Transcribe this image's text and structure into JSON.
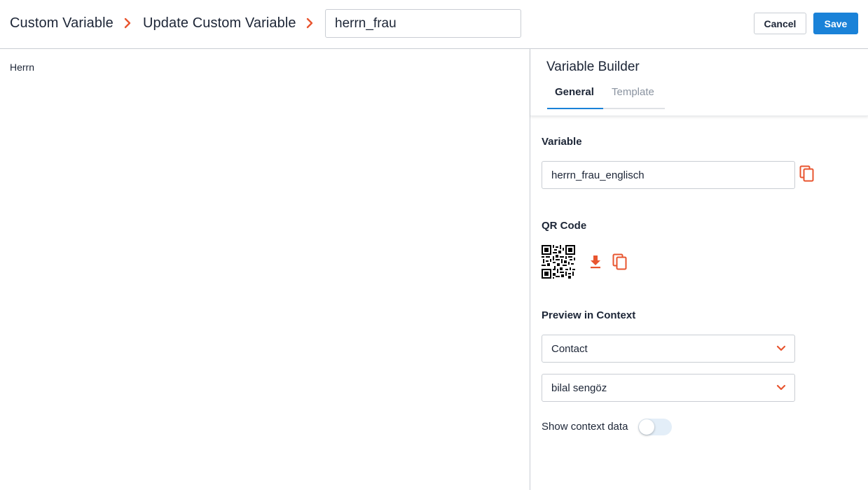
{
  "header": {
    "breadcrumb_root": "Custom Variable",
    "breadcrumb_current": "Update Custom Variable",
    "name_value": "herrn_frau",
    "cancel_label": "Cancel",
    "save_label": "Save"
  },
  "preview": {
    "output_text": "Herrn"
  },
  "builder": {
    "title": "Variable Builder",
    "tabs": [
      {
        "label": "General",
        "active": true
      },
      {
        "label": "Template",
        "active": false
      }
    ],
    "variable_label": "Variable",
    "variable_value": "herrn_frau_englisch",
    "qr_label": "QR Code",
    "preview_label": "Preview in Context",
    "context_type_value": "Contact",
    "context_record_value": "bilal sengöz",
    "show_context_label": "Show context data",
    "show_context_on": false
  },
  "icons": {
    "chevron": "chevron-right-icon",
    "copy": "copy-icon",
    "download": "download-icon",
    "dropdown": "chevron-down-icon"
  },
  "colors": {
    "accent": "#e8552f",
    "primary": "#1a82d8",
    "border": "#c9cdd3",
    "text": "#1c2536"
  }
}
